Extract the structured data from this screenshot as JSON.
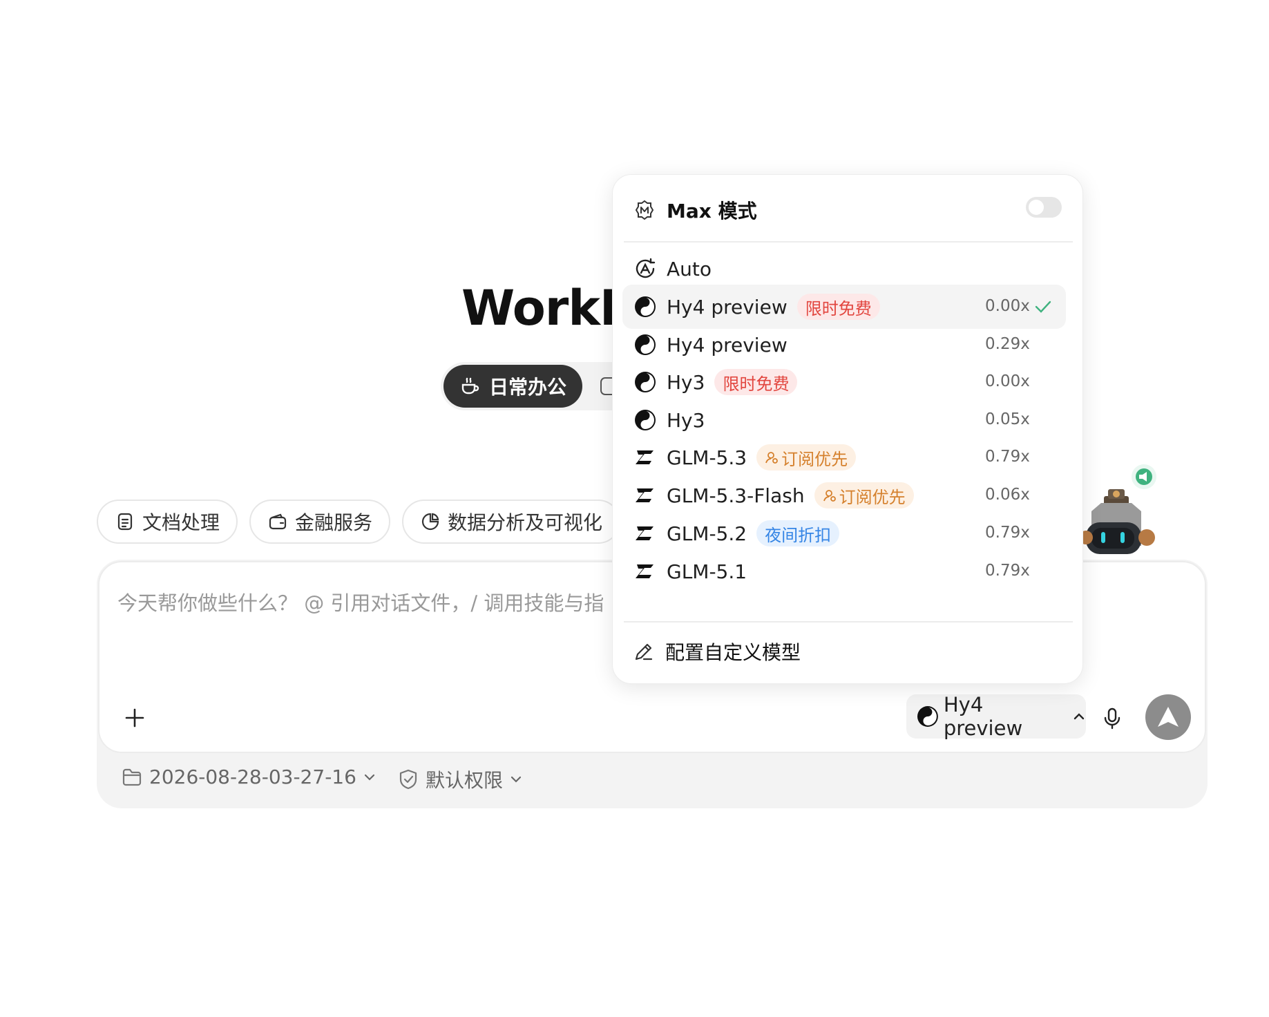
{
  "app": {
    "title": "WorkBu"
  },
  "modes": {
    "active_label": "日常办公"
  },
  "chips": [
    {
      "label": "文档处理",
      "icon": "document-icon"
    },
    {
      "label": "金融服务",
      "icon": "wallet-icon"
    },
    {
      "label": "数据分析及可视化",
      "icon": "pie-chart-icon"
    }
  ],
  "composer": {
    "placeholder": "今天帮你做些什么？ @ 引用对话文件，/ 调用技能与指",
    "model_button_label": "Hy4 preview",
    "workspace": "2026-08-28-03-27-16",
    "permission": "默认权限"
  },
  "dropdown": {
    "max_mode_label": "Max 模式",
    "max_mode_on": false,
    "options": [
      {
        "name": "Auto",
        "logo": "auto-icon",
        "badge": "",
        "badge_type": "",
        "multiplier": "",
        "selected": false
      },
      {
        "name": "Hy4 preview",
        "logo": "hunyuan-icon",
        "badge": "限时免费",
        "badge_type": "red",
        "multiplier": "0.00x",
        "selected": true
      },
      {
        "name": "Hy4 preview",
        "logo": "hunyuan-icon",
        "badge": "",
        "badge_type": "",
        "multiplier": "0.29x",
        "selected": false
      },
      {
        "name": "Hy3",
        "logo": "hunyuan-icon",
        "badge": "限时免费",
        "badge_type": "red",
        "multiplier": "0.00x",
        "selected": false
      },
      {
        "name": "Hy3",
        "logo": "hunyuan-icon",
        "badge": "",
        "badge_type": "",
        "multiplier": "0.05x",
        "selected": false
      },
      {
        "name": "GLM-5.3",
        "logo": "zhipu-icon",
        "badge": "订阅优先",
        "badge_type": "orange",
        "multiplier": "0.79x",
        "selected": false
      },
      {
        "name": "GLM-5.3-Flash",
        "logo": "zhipu-icon",
        "badge": "订阅优先",
        "badge_type": "orange",
        "multiplier": "0.06x",
        "selected": false
      },
      {
        "name": "GLM-5.2",
        "logo": "zhipu-icon",
        "badge": "夜间折扣",
        "badge_type": "blue",
        "multiplier": "0.79x",
        "selected": false
      },
      {
        "name": "GLM-5.1",
        "logo": "zhipu-icon",
        "badge": "",
        "badge_type": "",
        "multiplier": "0.79x",
        "selected": false
      }
    ],
    "config_label": "配置自定义模型"
  },
  "colors": {
    "accent_dark": "#333333",
    "badge_red": "#e2463f",
    "badge_orange": "#d5802c",
    "badge_blue": "#3585e5",
    "check_green": "#3fb27f",
    "send_button": "#8c8c8c"
  }
}
